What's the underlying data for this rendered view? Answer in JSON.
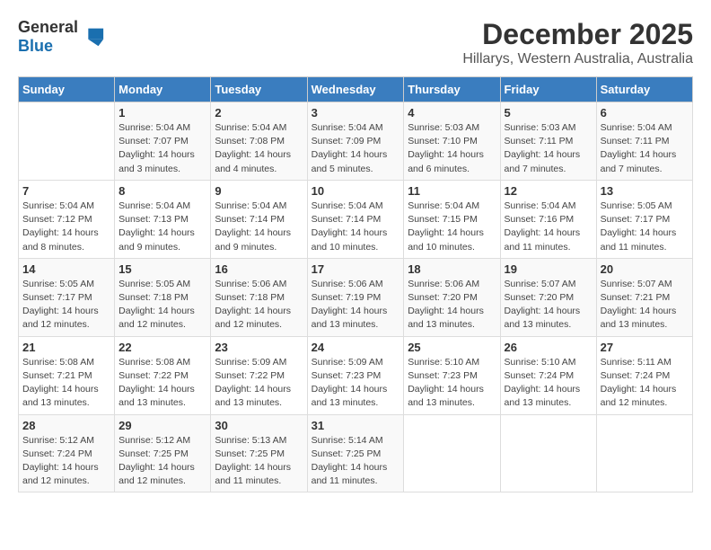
{
  "header": {
    "logo_general": "General",
    "logo_blue": "Blue",
    "title": "December 2025",
    "subtitle": "Hillarys, Western Australia, Australia"
  },
  "weekdays": [
    "Sunday",
    "Monday",
    "Tuesday",
    "Wednesday",
    "Thursday",
    "Friday",
    "Saturday"
  ],
  "weeks": [
    [
      {
        "day": "",
        "sunrise": "",
        "sunset": "",
        "daylight": ""
      },
      {
        "day": "1",
        "sunrise": "Sunrise: 5:04 AM",
        "sunset": "Sunset: 7:07 PM",
        "daylight": "Daylight: 14 hours and 3 minutes."
      },
      {
        "day": "2",
        "sunrise": "Sunrise: 5:04 AM",
        "sunset": "Sunset: 7:08 PM",
        "daylight": "Daylight: 14 hours and 4 minutes."
      },
      {
        "day": "3",
        "sunrise": "Sunrise: 5:04 AM",
        "sunset": "Sunset: 7:09 PM",
        "daylight": "Daylight: 14 hours and 5 minutes."
      },
      {
        "day": "4",
        "sunrise": "Sunrise: 5:03 AM",
        "sunset": "Sunset: 7:10 PM",
        "daylight": "Daylight: 14 hours and 6 minutes."
      },
      {
        "day": "5",
        "sunrise": "Sunrise: 5:03 AM",
        "sunset": "Sunset: 7:11 PM",
        "daylight": "Daylight: 14 hours and 7 minutes."
      },
      {
        "day": "6",
        "sunrise": "Sunrise: 5:04 AM",
        "sunset": "Sunset: 7:11 PM",
        "daylight": "Daylight: 14 hours and 7 minutes."
      }
    ],
    [
      {
        "day": "7",
        "sunrise": "Sunrise: 5:04 AM",
        "sunset": "Sunset: 7:12 PM",
        "daylight": "Daylight: 14 hours and 8 minutes."
      },
      {
        "day": "8",
        "sunrise": "Sunrise: 5:04 AM",
        "sunset": "Sunset: 7:13 PM",
        "daylight": "Daylight: 14 hours and 9 minutes."
      },
      {
        "day": "9",
        "sunrise": "Sunrise: 5:04 AM",
        "sunset": "Sunset: 7:14 PM",
        "daylight": "Daylight: 14 hours and 9 minutes."
      },
      {
        "day": "10",
        "sunrise": "Sunrise: 5:04 AM",
        "sunset": "Sunset: 7:14 PM",
        "daylight": "Daylight: 14 hours and 10 minutes."
      },
      {
        "day": "11",
        "sunrise": "Sunrise: 5:04 AM",
        "sunset": "Sunset: 7:15 PM",
        "daylight": "Daylight: 14 hours and 10 minutes."
      },
      {
        "day": "12",
        "sunrise": "Sunrise: 5:04 AM",
        "sunset": "Sunset: 7:16 PM",
        "daylight": "Daylight: 14 hours and 11 minutes."
      },
      {
        "day": "13",
        "sunrise": "Sunrise: 5:05 AM",
        "sunset": "Sunset: 7:17 PM",
        "daylight": "Daylight: 14 hours and 11 minutes."
      }
    ],
    [
      {
        "day": "14",
        "sunrise": "Sunrise: 5:05 AM",
        "sunset": "Sunset: 7:17 PM",
        "daylight": "Daylight: 14 hours and 12 minutes."
      },
      {
        "day": "15",
        "sunrise": "Sunrise: 5:05 AM",
        "sunset": "Sunset: 7:18 PM",
        "daylight": "Daylight: 14 hours and 12 minutes."
      },
      {
        "day": "16",
        "sunrise": "Sunrise: 5:06 AM",
        "sunset": "Sunset: 7:18 PM",
        "daylight": "Daylight: 14 hours and 12 minutes."
      },
      {
        "day": "17",
        "sunrise": "Sunrise: 5:06 AM",
        "sunset": "Sunset: 7:19 PM",
        "daylight": "Daylight: 14 hours and 13 minutes."
      },
      {
        "day": "18",
        "sunrise": "Sunrise: 5:06 AM",
        "sunset": "Sunset: 7:20 PM",
        "daylight": "Daylight: 14 hours and 13 minutes."
      },
      {
        "day": "19",
        "sunrise": "Sunrise: 5:07 AM",
        "sunset": "Sunset: 7:20 PM",
        "daylight": "Daylight: 14 hours and 13 minutes."
      },
      {
        "day": "20",
        "sunrise": "Sunrise: 5:07 AM",
        "sunset": "Sunset: 7:21 PM",
        "daylight": "Daylight: 14 hours and 13 minutes."
      }
    ],
    [
      {
        "day": "21",
        "sunrise": "Sunrise: 5:08 AM",
        "sunset": "Sunset: 7:21 PM",
        "daylight": "Daylight: 14 hours and 13 minutes."
      },
      {
        "day": "22",
        "sunrise": "Sunrise: 5:08 AM",
        "sunset": "Sunset: 7:22 PM",
        "daylight": "Daylight: 14 hours and 13 minutes."
      },
      {
        "day": "23",
        "sunrise": "Sunrise: 5:09 AM",
        "sunset": "Sunset: 7:22 PM",
        "daylight": "Daylight: 14 hours and 13 minutes."
      },
      {
        "day": "24",
        "sunrise": "Sunrise: 5:09 AM",
        "sunset": "Sunset: 7:23 PM",
        "daylight": "Daylight: 14 hours and 13 minutes."
      },
      {
        "day": "25",
        "sunrise": "Sunrise: 5:10 AM",
        "sunset": "Sunset: 7:23 PM",
        "daylight": "Daylight: 14 hours and 13 minutes."
      },
      {
        "day": "26",
        "sunrise": "Sunrise: 5:10 AM",
        "sunset": "Sunset: 7:24 PM",
        "daylight": "Daylight: 14 hours and 13 minutes."
      },
      {
        "day": "27",
        "sunrise": "Sunrise: 5:11 AM",
        "sunset": "Sunset: 7:24 PM",
        "daylight": "Daylight: 14 hours and 12 minutes."
      }
    ],
    [
      {
        "day": "28",
        "sunrise": "Sunrise: 5:12 AM",
        "sunset": "Sunset: 7:24 PM",
        "daylight": "Daylight: 14 hours and 12 minutes."
      },
      {
        "day": "29",
        "sunrise": "Sunrise: 5:12 AM",
        "sunset": "Sunset: 7:25 PM",
        "daylight": "Daylight: 14 hours and 12 minutes."
      },
      {
        "day": "30",
        "sunrise": "Sunrise: 5:13 AM",
        "sunset": "Sunset: 7:25 PM",
        "daylight": "Daylight: 14 hours and 11 minutes."
      },
      {
        "day": "31",
        "sunrise": "Sunrise: 5:14 AM",
        "sunset": "Sunset: 7:25 PM",
        "daylight": "Daylight: 14 hours and 11 minutes."
      },
      {
        "day": "",
        "sunrise": "",
        "sunset": "",
        "daylight": ""
      },
      {
        "day": "",
        "sunrise": "",
        "sunset": "",
        "daylight": ""
      },
      {
        "day": "",
        "sunrise": "",
        "sunset": "",
        "daylight": ""
      }
    ]
  ]
}
